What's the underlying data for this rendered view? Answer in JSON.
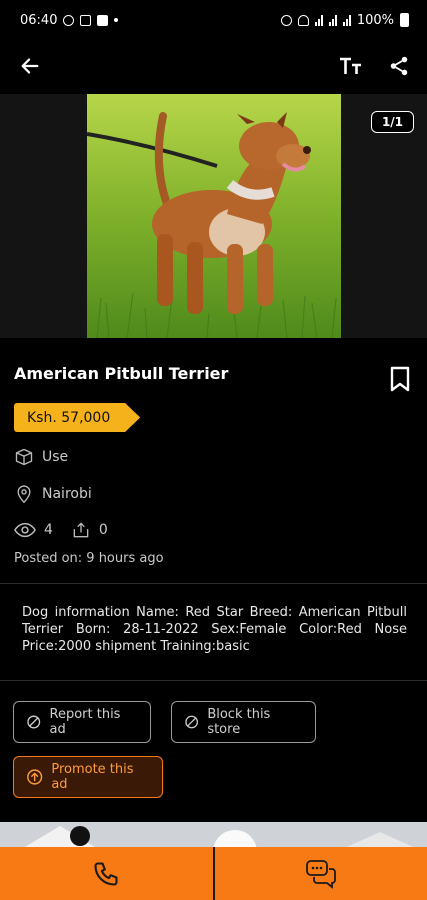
{
  "status_bar": {
    "time": "06:40",
    "battery": "100%"
  },
  "listing": {
    "title": "American Pitbull Terrier",
    "price": "Ksh. 57,000",
    "condition": "Use",
    "location": "Nairobi",
    "views": "4",
    "shares": "0",
    "posted": "Posted on: 9 hours ago",
    "image_counter": "1/1",
    "description": "Dog information Name: Red Star Breed: American Pitbull Terrier Born: 28-11-2022 Sex:Female Color:Red Nose Price:2000 shipment Training:basic"
  },
  "actions": {
    "report_label": "Report this ad",
    "block_label": "Block this store",
    "promote_label": "Promote this ad"
  },
  "icons": {
    "back": "arrow-left-icon",
    "text_size": "text-size-icon",
    "share": "share-icon",
    "bookmark": "bookmark-icon",
    "condition": "box-icon",
    "location": "location-pin-icon",
    "views": "eye-icon",
    "shares": "share-out-icon",
    "call": "phone-icon",
    "chat": "chat-icon"
  },
  "colors": {
    "accent": "#f77a15",
    "price_tag": "#f6b21b",
    "background": "#000000"
  }
}
